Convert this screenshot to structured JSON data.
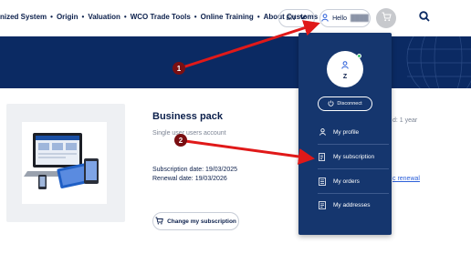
{
  "nav": {
    "links": [
      "nized System",
      "Origin",
      "Valuation",
      "WCO Trade Tools",
      "Online Training",
      "About Customs"
    ],
    "separator": "•",
    "language": "EN",
    "user_label": "Hello",
    "user_name_blurred": "████"
  },
  "product": {
    "title": "Business pack",
    "subtitle": "Single user users account",
    "subscription_date": "Subscription date: 19/03/2025",
    "renewal_date": "Renewal date: 19/03/2026",
    "change_button": "Change my subscription",
    "right_meta": "d: 1 year",
    "right_link": "c renewal"
  },
  "dropdown": {
    "avatar_initial": "Z",
    "disconnect_label": "Disconnect",
    "items": [
      {
        "label": "My profile",
        "icon": "person-icon"
      },
      {
        "label": "My subscription",
        "icon": "document-icon"
      },
      {
        "label": "My orders",
        "icon": "list-icon"
      },
      {
        "label": "My addresses",
        "icon": "address-icon"
      }
    ]
  },
  "annotations": {
    "markers": [
      "1",
      "2"
    ],
    "arrow_color": "#e01919",
    "marker_color": "#7a0f12"
  },
  "colors": {
    "navy": "#0b2a63",
    "dropdown": "#15366e",
    "text": "#0b1f4b",
    "online": "#3ec46d"
  }
}
